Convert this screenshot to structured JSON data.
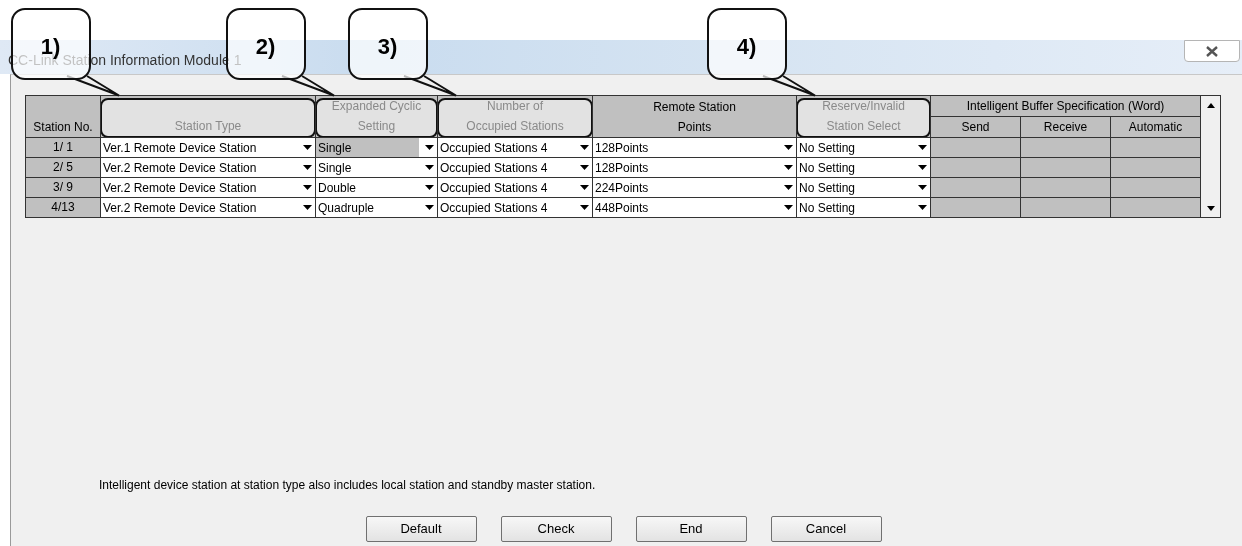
{
  "window": {
    "title": "CC-Link Station Information Module 1"
  },
  "table": {
    "columns": [
      {
        "label": "Station No.",
        "highlighted": false
      },
      {
        "label": "Station Type",
        "highlighted": true,
        "callout": "1)"
      },
      {
        "label": "Expanded Cyclic\nSetting",
        "highlighted": true,
        "callout": "2)"
      },
      {
        "label": "Number of\nOccupied Stations",
        "highlighted": true,
        "callout": "3)"
      },
      {
        "label": "Remote Station\nPoints",
        "highlighted": false
      },
      {
        "label": "Reserve/Invalid\nStation Select",
        "highlighted": true,
        "callout": "4)"
      }
    ],
    "group": {
      "label": "Intelligent Buffer Specification (Word)",
      "columns": [
        "Send",
        "Receive",
        "Automatic"
      ]
    },
    "rows": [
      {
        "cells": [
          {
            "kind": "label",
            "value": "1/ 1"
          },
          {
            "kind": "dropdown",
            "value": "Ver.1 Remote Device Station",
            "selected": false
          },
          {
            "kind": "dropdown",
            "value": "Single",
            "selected": true
          },
          {
            "kind": "dropdown",
            "value": "Occupied Stations 4",
            "selected": false
          },
          {
            "kind": "dropdown",
            "value": "128Points",
            "selected": false
          },
          {
            "kind": "dropdown",
            "value": "No Setting",
            "selected": false
          }
        ]
      },
      {
        "cells": [
          {
            "kind": "label",
            "value": "2/ 5"
          },
          {
            "kind": "dropdown",
            "value": "Ver.2 Remote Device Station",
            "selected": false
          },
          {
            "kind": "dropdown",
            "value": "Single",
            "selected": false
          },
          {
            "kind": "dropdown",
            "value": "Occupied Stations 4",
            "selected": false
          },
          {
            "kind": "dropdown",
            "value": "128Points",
            "selected": false
          },
          {
            "kind": "dropdown",
            "value": "No Setting",
            "selected": false
          }
        ]
      },
      {
        "cells": [
          {
            "kind": "label",
            "value": "3/ 9"
          },
          {
            "kind": "dropdown",
            "value": "Ver.2 Remote Device Station",
            "selected": false
          },
          {
            "kind": "dropdown",
            "value": "Double",
            "selected": false
          },
          {
            "kind": "dropdown",
            "value": "Occupied Stations 4",
            "selected": false
          },
          {
            "kind": "dropdown",
            "value": "224Points",
            "selected": false
          },
          {
            "kind": "dropdown",
            "value": "No Setting",
            "selected": false
          }
        ]
      },
      {
        "cells": [
          {
            "kind": "label",
            "value": "4/13"
          },
          {
            "kind": "dropdown",
            "value": "Ver.2 Remote Device Station",
            "selected": false
          },
          {
            "kind": "dropdown",
            "value": "Quadruple",
            "selected": false
          },
          {
            "kind": "dropdown",
            "value": "Occupied Stations 4",
            "selected": false
          },
          {
            "kind": "dropdown",
            "value": "448Points",
            "selected": false
          },
          {
            "kind": "dropdown",
            "value": "No Setting",
            "selected": false
          }
        ]
      }
    ]
  },
  "note": "Intelligent device station at station type also includes local station and standby master station.",
  "buttons": [
    "Default",
    "Check",
    "End",
    "Cancel"
  ]
}
